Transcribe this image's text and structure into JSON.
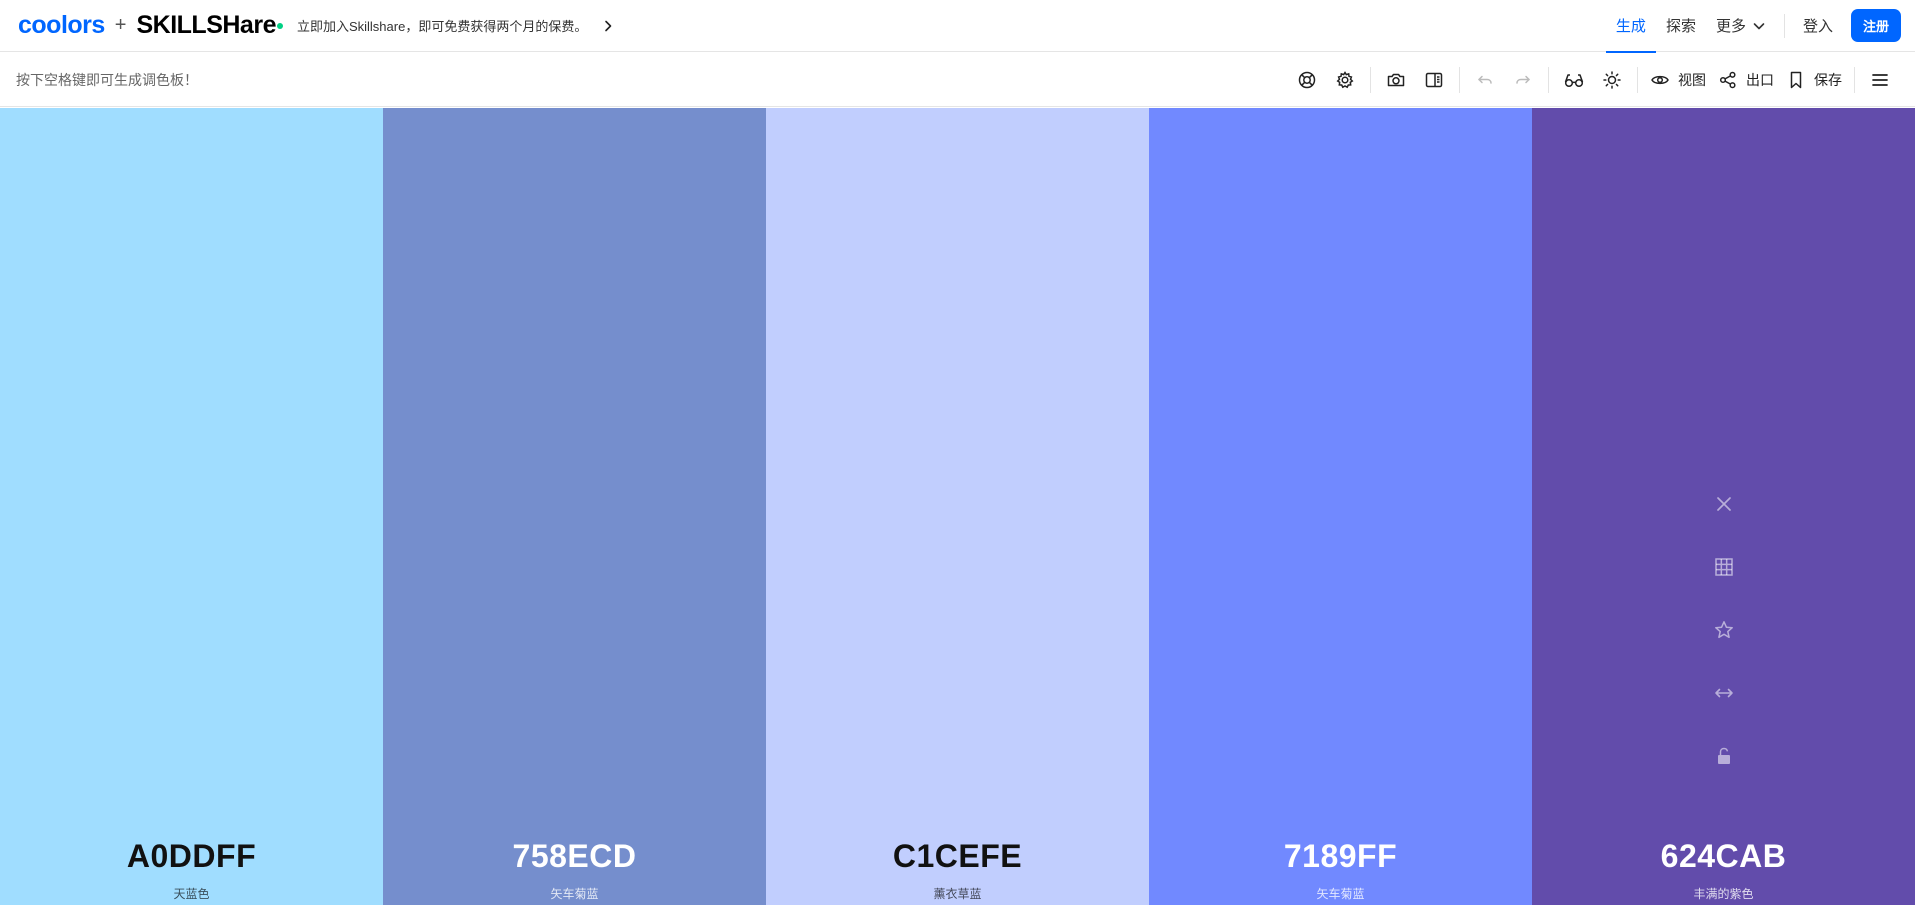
{
  "header": {
    "brand_coolors": "coolors",
    "brand_plus": "+",
    "brand_skillshare": "SKILLSHare",
    "promo_text": "立即加入Skillshare，即可免费获得两个月的保费。",
    "nav": {
      "generate": "生成",
      "explore": "探索",
      "more": "更多",
      "login": "登入",
      "signup": "注册"
    }
  },
  "toolbar": {
    "hint": "按下空格键即可生成调色板！",
    "view_label": "视图",
    "export_label": "出口",
    "save_label": "保存",
    "icons": [
      "lifebuoy-icon",
      "settings-icon",
      "camera-icon",
      "sidebar-icon",
      "undo-icon",
      "redo-icon",
      "glasses-icon",
      "sun-icon",
      "eye-icon",
      "share-icon",
      "bookmark-icon",
      "menu-icon"
    ]
  },
  "palette": {
    "colors": [
      {
        "hex": "A0DDFF",
        "name": "天蓝色",
        "color": "#A0DDFF",
        "text_theme": "light"
      },
      {
        "hex": "758ECD",
        "name": "矢车菊蓝",
        "color": "#758ECD",
        "text_theme": "dark"
      },
      {
        "hex": "C1CEFE",
        "name": "薰衣草蓝",
        "color": "#C1CEFE",
        "text_theme": "light"
      },
      {
        "hex": "7189FF",
        "name": "矢车菊蓝",
        "color": "#7189FF",
        "text_theme": "dark"
      },
      {
        "hex": "624CAB",
        "name": "丰满的紫色",
        "color": "#624CAB",
        "text_theme": "dark"
      }
    ],
    "hovered_swatch_tools": [
      "close-icon",
      "shades-grid-icon",
      "star-icon",
      "drag-horizontal-icon",
      "unlock-icon"
    ]
  },
  "colors": {
    "accent": "#0066ff",
    "skillshare_dot": "#00d084"
  }
}
